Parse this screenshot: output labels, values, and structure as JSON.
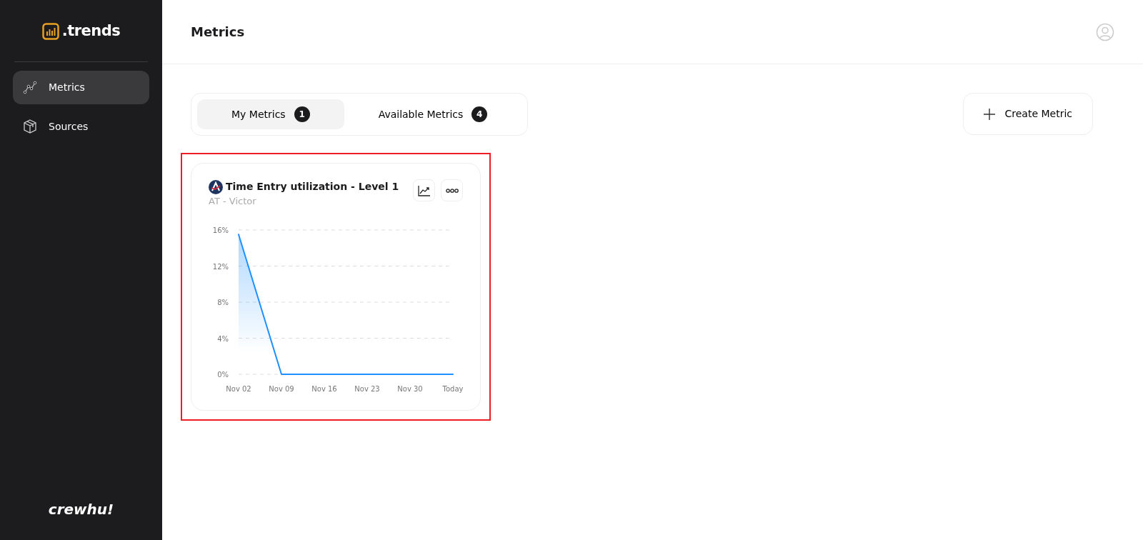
{
  "sidebar": {
    "logo": ".trends",
    "items": [
      {
        "label": "Metrics",
        "kind": "chart",
        "selected": true
      },
      {
        "label": "Sources",
        "kind": "box",
        "selected": false
      }
    ],
    "footer_logo": "crewhu!"
  },
  "header": {
    "title": "Metrics"
  },
  "tabs": [
    {
      "label": "My Metrics",
      "count": "1",
      "selected": true
    },
    {
      "label": "Available Metrics",
      "count": "4",
      "selected": false
    }
  ],
  "create_button": {
    "label": "Create Metric"
  },
  "cards": [
    {
      "title": "Time Entry utilization - Level 1",
      "subtitle": "AT - Victor",
      "highlighted": true,
      "chart_data": {
        "type": "area",
        "categories": [
          "Nov 02",
          "Nov 09",
          "Nov 16",
          "Nov 23",
          "Nov 30",
          "Today"
        ],
        "series": [
          {
            "color": "#1e90ff",
            "values": [
              15.5,
              0,
              0,
              0,
              0,
              0
            ]
          }
        ],
        "grid": true,
        "ylim": [
          0,
          16
        ],
        "yticks": [
          {
            "value": 0,
            "label": "0%"
          },
          {
            "value": 4,
            "label": "4%"
          },
          {
            "value": 8,
            "label": "8%"
          },
          {
            "value": 12,
            "label": "12%"
          },
          {
            "value": 16,
            "label": "16%"
          }
        ]
      }
    }
  ]
}
